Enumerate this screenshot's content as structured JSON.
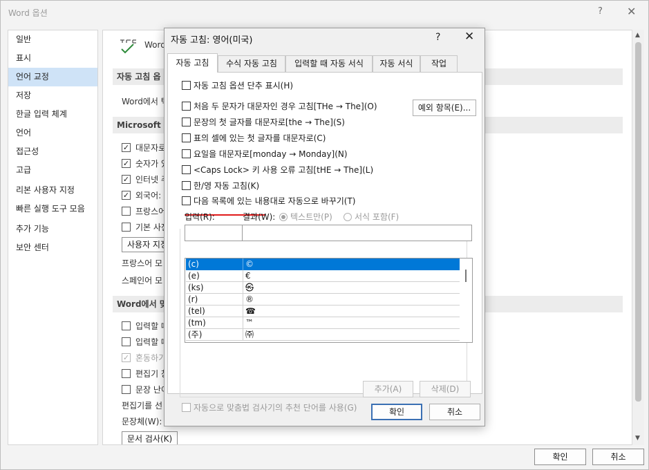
{
  "outer": {
    "title": "Word 옵션",
    "help": "?",
    "close": "✕",
    "nav": [
      "일반",
      "표시",
      "언어 교정",
      "저장",
      "한글 입력 체계",
      "언어",
      "접근성",
      "고급",
      "리본 사용자 지정",
      "빠른 실행 도구 모음",
      "추가 기능",
      "보안 센터"
    ],
    "selected_nav": "언어 교정",
    "content": {
      "head": "Word",
      "section1": "자동 고침 옵",
      "line1": "Word에서 텍",
      "section2": "Microsoft Of",
      "checks": [
        {
          "label": "대문자로",
          "checked": true
        },
        {
          "label": "숫자가 있",
          "checked": true
        },
        {
          "label": "인터넷 주",
          "checked": true
        },
        {
          "label": "외국어:",
          "checked": true
        },
        {
          "label": "프랑스어",
          "checked": false
        },
        {
          "label": "기본 사전",
          "checked": false
        }
      ],
      "user_dict_btn": "사용자 지정",
      "french_mode": "프랑스어 모",
      "spanish_mode": "스페인어 모",
      "section3": "Word에서 맞",
      "checks2": [
        {
          "label": "입력할 때",
          "checked": false,
          "dim": false
        },
        {
          "label": "입력할 때",
          "checked": false,
          "dim": false
        },
        {
          "label": "혼동하기",
          "checked": true,
          "dim": true
        },
        {
          "label": "편집기 창",
          "checked": false,
          "dim": false
        },
        {
          "label": "문장 난이",
          "checked": false,
          "dim": false
        }
      ],
      "editor_line": "편집기를 선",
      "style_line": "문장체(W):",
      "doc_check_btn": "문서 검사(K)"
    },
    "ok": "확인",
    "cancel": "취소"
  },
  "dialog": {
    "title": "자동 고침: 영어(미국)",
    "help": "?",
    "close": "✕",
    "tabs": [
      "자동 고침",
      "수식 자동 고침",
      "입력할 때 자동 서식",
      "자동 서식",
      "작업"
    ],
    "active_tab": "자동 고침",
    "show_buttons": "자동 고침 옵션 단추 표시(H)",
    "exceptions_btn": "예외 항목(E)...",
    "options": [
      "처음 두 문자가 대문자인 경우 고침[THe → The](O)",
      "문장의 첫 글자를 대문자로[the → The](S)",
      "표의 셀에 있는 첫 글자를 대문자로(C)",
      "요일을 대문자로[monday → Monday](N)",
      "<Caps Lock> 키 사용 오류 고침[tHE → The](L)",
      "한/영 자동 고침(K)",
      "다음 목록에 있는 내용대로 자동으로 바꾸기(T)"
    ],
    "input_label": "입력(R):",
    "result_label": "결과(W):",
    "radio_plain": "텍스트만(P)",
    "radio_format": "서식 포함(F)",
    "input_value": "",
    "result_value": "",
    "entries": [
      {
        "key": "(c)",
        "value": "©"
      },
      {
        "key": "(e)",
        "value": "€"
      },
      {
        "key": "(ks)",
        "value": "㉿"
      },
      {
        "key": "(r)",
        "value": "®"
      },
      {
        "key": "(tel)",
        "value": "☎"
      },
      {
        "key": "(tm)",
        "value": "™"
      },
      {
        "key": "(주)",
        "value": "㈜"
      }
    ],
    "add_btn": "추가(A)",
    "delete_btn": "삭제(D)",
    "suggest_option": "자동으로 맞춤법 검사기의 추천 단어를 사용(G)",
    "ok": "확인",
    "cancel": "취소"
  },
  "colors": {
    "selection": "#0078d7",
    "nav_selected": "#cfe3f7",
    "annotation_underline": "#e01a1a"
  }
}
